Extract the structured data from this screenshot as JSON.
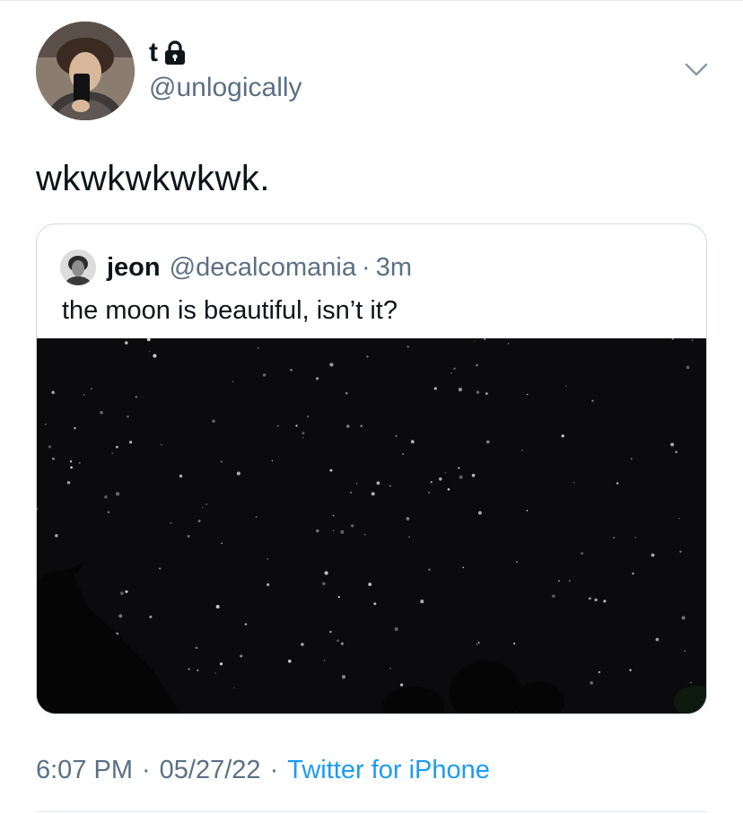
{
  "author": {
    "display_name": "t",
    "handle": "@unlogically",
    "protected_icon": "lock-icon",
    "avatar_icon": "profile-photo"
  },
  "tweet": {
    "text": "wkwkwkwkwk."
  },
  "quoted_tweet": {
    "display_name": "jeon",
    "handle": "@decalcomania",
    "separator": "·",
    "time": "3m",
    "text": "the moon is beautiful, isn’t it?",
    "media": "night-sky-photo"
  },
  "meta": {
    "time": "6:07 PM",
    "separator": "·",
    "date": "05/27/22",
    "source": "Twitter for iPhone"
  },
  "colors": {
    "secondary_text": "#5b7083",
    "link": "#1d9bf0",
    "border": "#cfd9de"
  }
}
